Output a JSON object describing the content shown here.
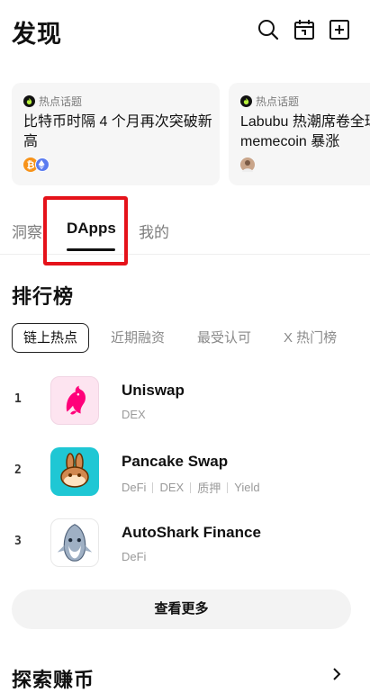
{
  "header": {
    "title": "发现",
    "icons": [
      "search-icon",
      "calendar-icon",
      "add-icon"
    ]
  },
  "hot_topics": [
    {
      "tag": "热点话题",
      "title": "比特币时隔 4 个月再次突破新高",
      "coins": [
        "btc-coin-icon",
        "eth-coin-icon"
      ]
    },
    {
      "tag": "热点话题",
      "title_line1": "Labubu 热潮席卷全球",
      "title_line2": "memecoin 暴涨",
      "coins": [
        "avatar-icon"
      ]
    }
  ],
  "tabs": [
    {
      "label": "洞察",
      "active": false
    },
    {
      "label": "DApps",
      "active": true
    },
    {
      "label": "我的",
      "active": false
    }
  ],
  "ranking": {
    "title": "排行榜",
    "filters": [
      {
        "label": "链上热点",
        "selected": true
      },
      {
        "label": "近期融资",
        "selected": false
      },
      {
        "label": "最受认可",
        "selected": false
      },
      {
        "label": "X 热门榜",
        "selected": false
      }
    ],
    "items": [
      {
        "rank": "1",
        "name": "Uniswap",
        "tags": [
          "DEX"
        ],
        "logo": "uniswap-logo-icon"
      },
      {
        "rank": "2",
        "name": "Pancake Swap",
        "tags": [
          "DeFi",
          "DEX",
          "质押",
          "Yield"
        ],
        "logo": "pancakeswap-logo-icon"
      },
      {
        "rank": "3",
        "name": "AutoShark Finance",
        "tags": [
          "DeFi"
        ],
        "logo": "autoshark-logo-icon"
      }
    ],
    "more_label": "查看更多"
  },
  "next_section": {
    "title": "探索赚币"
  },
  "colors": {
    "highlight": "#e5121a",
    "uniswap": "#ff007a",
    "pancake": "#d1884f"
  }
}
